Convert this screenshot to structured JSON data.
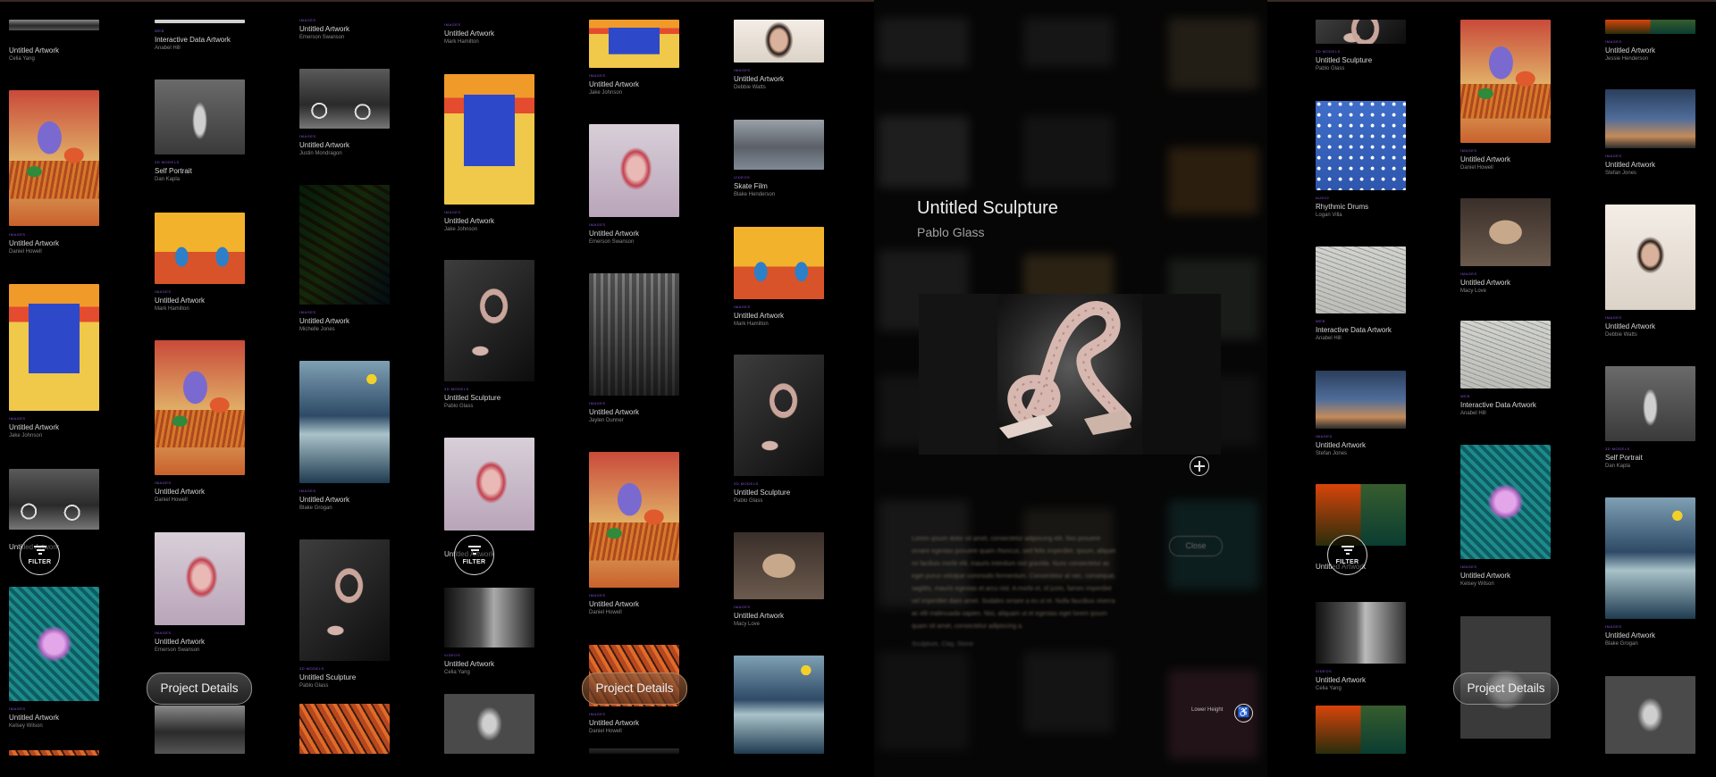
{
  "cat": {
    "images": "IMAGES",
    "web": "WEB",
    "3d": "3D MODELS",
    "video": "VIDEOS",
    "audio": "AUDIO"
  },
  "cards": {
    "c1a": {
      "title": "Untitled Artwork",
      "artist": "Celia Yang"
    },
    "c1b": {
      "title": "Untitled Artwork",
      "artist": "Daniel Howell"
    },
    "c1c": {
      "title": "Untitled Artwork",
      "artist": "Jake Johnson"
    },
    "c1e": {
      "title": "Untitled Artwork",
      "artist": "Kelsey Wilson"
    },
    "c2a": {
      "title": "Interactive Data Artwork",
      "artist": "Anabel Hill"
    },
    "c2b": {
      "title": "Self Portrait",
      "artist": "Dan Kapla"
    },
    "c2c": {
      "title": "Untitled Artwork",
      "artist": "Mark Hamilton"
    },
    "c2d": {
      "title": "Untitled Artwork",
      "artist": "Daniel Howell"
    },
    "c2e": {
      "title": "Untitled Artwork",
      "artist": "Emerson Swanson"
    },
    "c3a": {
      "title": "Untitled Artwork",
      "artist": "Emerson Swanson"
    },
    "c3b": {
      "title": "Untitled Artwork",
      "artist": "Justin Mondragon"
    },
    "c3c": {
      "title": "Untitled Artwork",
      "artist": "Michelle Jones"
    },
    "c3d": {
      "title": "Untitled Artwork",
      "artist": "Blake Grogan"
    },
    "c3e": {
      "title": "Untitled Sculpture",
      "artist": "Pablo Glass"
    },
    "c4a": {
      "title": "Untitled Artwork",
      "artist": "Mark Hamilton"
    },
    "c4b": {
      "title": "Untitled Artwork",
      "artist": "Jake Johnson"
    },
    "c4c": {
      "title": "Untitled Sculpture",
      "artist": "Pablo Glass"
    },
    "c4e": {
      "title": "Untitled Artwork",
      "artist": "Celia Yang"
    },
    "c5a": {
      "title": "Untitled Artwork",
      "artist": "Jake Johnson"
    },
    "c5b": {
      "title": "Untitled Artwork",
      "artist": "Emerson Swanson"
    },
    "c5c": {
      "title": "Untitled Artwork",
      "artist": "Jaylen Dunner"
    },
    "c5d": {
      "title": "Untitled Artwork",
      "artist": "Daniel Howell"
    },
    "c5e": {
      "title": "Untitled Artwork",
      "artist": "Daniel Howell"
    },
    "c6a": {
      "title": "Untitled Artwork",
      "artist": "Debbie Watts"
    },
    "c6b": {
      "title": "Skate Film",
      "artist": "Blake Henderson"
    },
    "c6c": {
      "title": "Untitled Artwork",
      "artist": "Mark Hamilton"
    },
    "c6d": {
      "title": "Untitled Sculpture",
      "artist": "Pablo Glass"
    },
    "c6e": {
      "title": "Untitled Artwork",
      "artist": "Macy Love"
    },
    "c7a": {
      "title": "Untitled Sculpture",
      "artist": "Pablo Glass"
    },
    "c7b": {
      "title": "Rhythmic Drums",
      "artist": "Logan Villa"
    },
    "c7c": {
      "title": "Interactive Data Artwork",
      "artist": "Anabel Hill"
    },
    "c7d": {
      "title": "Untitled Artwork",
      "artist": "Stefan Jones"
    },
    "c7f": {
      "title": "Untitled Artwork",
      "artist": "Celia Yang"
    },
    "c8a": {
      "title": "Untitled Artwork",
      "artist": "Daniel Howell"
    },
    "c8b": {
      "title": "Untitled Artwork",
      "artist": "Macy Love"
    },
    "c8c": {
      "title": "Interactive Data Artwork",
      "artist": "Anabel Hill"
    },
    "c8d": {
      "title": "Untitled Artwork",
      "artist": "Kelsey Wilson"
    },
    "c9a": {
      "title": "Untitled Artwork",
      "artist": "Jessie Henderson"
    },
    "c9b": {
      "title": "Untitled Artwork",
      "artist": "Stefan Jones"
    },
    "c9c": {
      "title": "Untitled Artwork",
      "artist": "Debbie Watts"
    },
    "c9d": {
      "title": "Self Portrait",
      "artist": "Dan Kapla"
    },
    "c9e": {
      "title": "Untitled Artwork",
      "artist": "Blake Grogan"
    }
  },
  "detail": {
    "title": "Untitled Sculpture",
    "artist": "Pablo Glass",
    "body": "Lorem ipsum dolor sit amet, consectetur adipiscing elit. Nisi posuere ornare egestas posuere quam rhoncus, sed felis imperdiet. Ipsum, aliquet mi facilisis morbi elit, mauris interdum nisl gravida. Nunc consectetur ac eget purus volutpat commodo fermentum. Consectetur at nec, consequat, sagittis, mauris egestas et arcu nisl. A morbi et, id justo, fames imperdiet vel imperdiet diam amet. Sodales ornare a eu ut et. Nulla faucibus viverra ac elit malesuada sapien. Nisi, aliquam ut et egestas eget lorem ipsum quam sit amet, consectetur adipiscing a.",
    "tags": "Sculpture, Clay, Stone",
    "close_label": "Close",
    "lower_height_label": "Lower Height"
  },
  "filter_label": "FILTER",
  "project_details_label": "Project Details",
  "partial_labels": {
    "l1": "Untitled Artwork",
    "l4": "Untitled Artwork",
    "l7": "Untitled Artwork"
  }
}
